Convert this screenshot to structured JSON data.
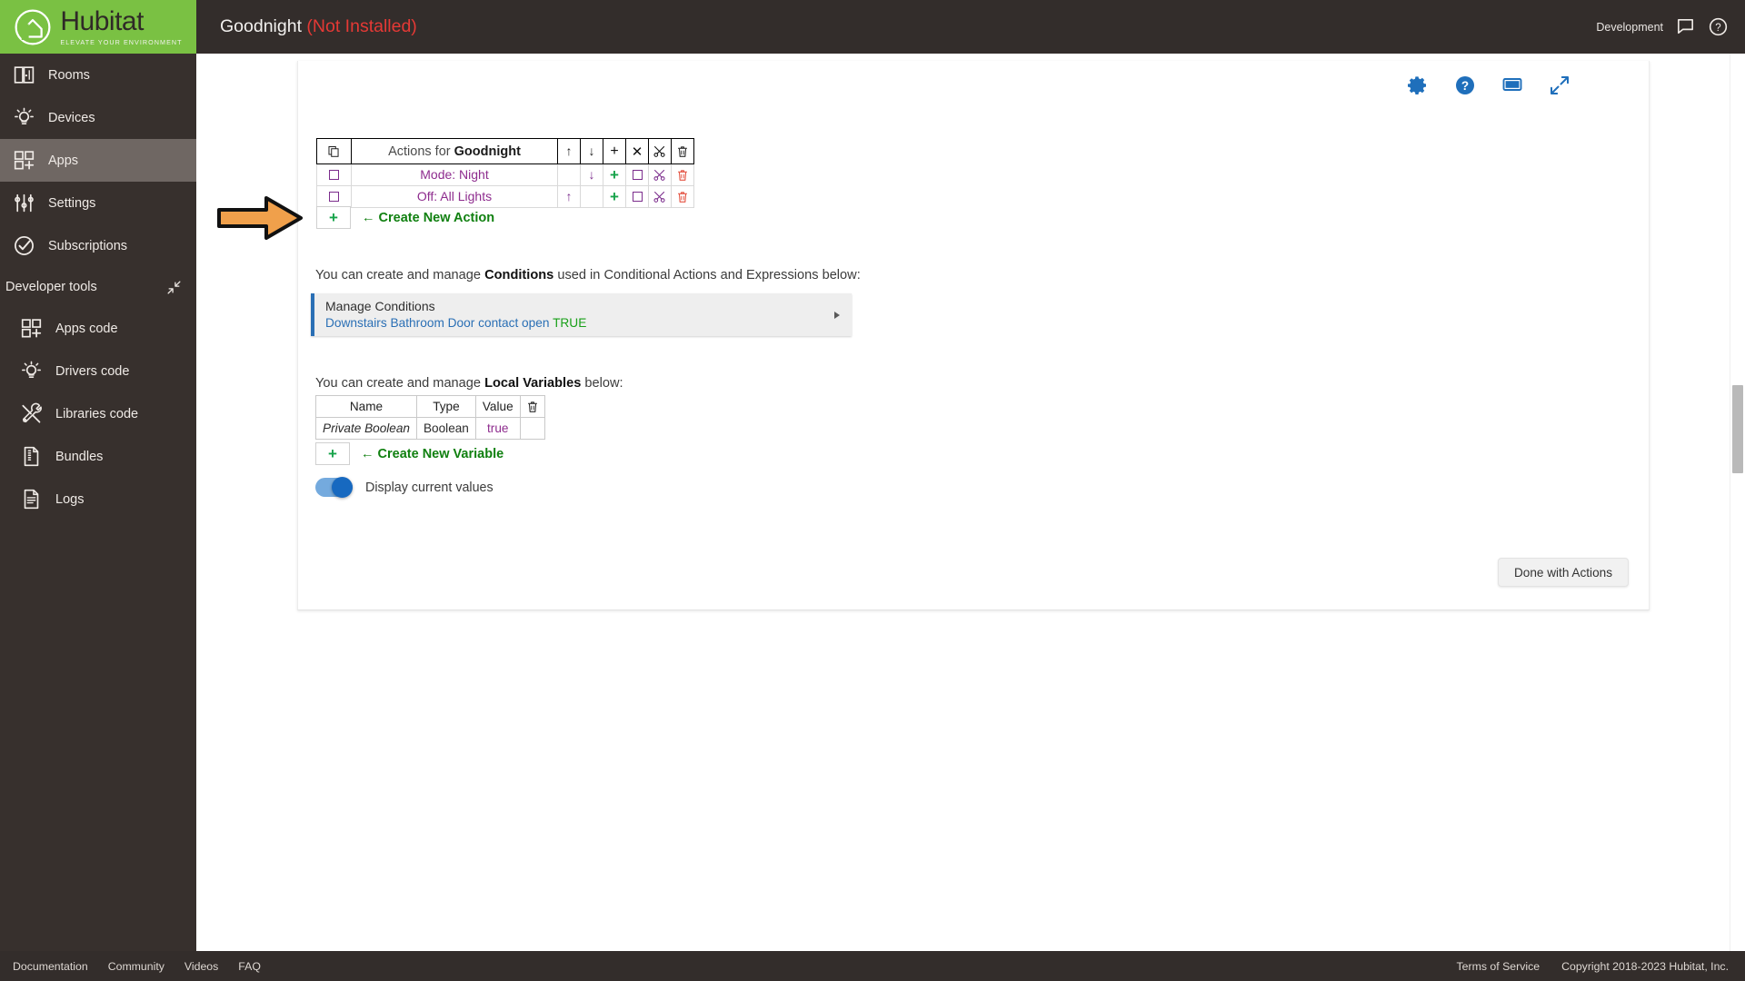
{
  "brand": {
    "name": "Hubitat",
    "tagline": "ELEVATE YOUR ENVIRONMENT",
    "logo_bg": "#7ac143"
  },
  "header": {
    "app_title": "Goodnight",
    "app_status": "(Not Installed)",
    "status_color": "#e53935",
    "environment": "Development",
    "icons": [
      "chat-bubble-icon",
      "help-circle-icon"
    ]
  },
  "sidebar": {
    "items": [
      {
        "label": "Rooms",
        "icon": "rooms-icon",
        "active": false
      },
      {
        "label": "Devices",
        "icon": "devices-bulb-icon",
        "active": false
      },
      {
        "label": "Apps",
        "icon": "apps-grid-icon",
        "active": true
      },
      {
        "label": "Settings",
        "icon": "settings-sliders-icon",
        "active": false
      },
      {
        "label": "Subscriptions",
        "icon": "subscriptions-check-icon",
        "active": false
      }
    ],
    "developer_tools": {
      "label": "Developer tools",
      "collapse_icon": "collapse-arrows-icon",
      "items": [
        {
          "label": "Apps code",
          "icon": "apps-grid-icon"
        },
        {
          "label": "Drivers code",
          "icon": "devices-bulb-icon"
        },
        {
          "label": "Libraries code",
          "icon": "tools-wrench-icon"
        },
        {
          "label": "Bundles",
          "icon": "bundle-zip-icon"
        },
        {
          "label": "Logs",
          "icon": "logs-document-icon"
        }
      ]
    }
  },
  "card_toolbar": {
    "icons": [
      {
        "name": "gear-icon",
        "color": "#1f6fbb"
      },
      {
        "name": "help-circle-icon",
        "color": "#1f6fbb"
      },
      {
        "name": "display-icon",
        "color": "#1f6fbb"
      },
      {
        "name": "expand-icon",
        "color": "#1f6fbb"
      }
    ]
  },
  "actions_table": {
    "header": {
      "copy_icon": "copy-pages-icon",
      "title_prefix": "Actions for ",
      "title_bold": "Goodnight",
      "ops": [
        "↑",
        "↓",
        "+",
        "✕",
        "scissors-icon",
        "trash-icon"
      ]
    },
    "rows": [
      {
        "checkbox": "square-checkbox-icon",
        "label": "Mode: Night",
        "up": "",
        "down": "↓",
        "plus": "+",
        "square": "square-icon",
        "cut": "scissors-icon",
        "delete": "trash-icon"
      },
      {
        "checkbox": "square-checkbox-icon",
        "label": "Off: All Lights",
        "up": "↑",
        "down": "",
        "plus": "+",
        "square": "square-icon",
        "cut": "scissors-icon",
        "delete": "trash-icon"
      }
    ],
    "create_new": {
      "plus": "+",
      "arrow": "←",
      "label": "Create New Action"
    }
  },
  "conditions": {
    "intro_before": "You can create and manage ",
    "intro_bold": "Conditions",
    "intro_after": " used in Conditional Actions and Expressions below:",
    "panel_title": "Manage Conditions",
    "panel_condition": "Downstairs Bathroom Door contact open ",
    "panel_value": "TRUE",
    "accent_color": "#2a6fb5",
    "value_color": "#18a018"
  },
  "variables": {
    "intro_before": "You can create and manage ",
    "intro_bold": "Local Variables",
    "intro_after": " below:",
    "columns": [
      "Name",
      "Type",
      "Value"
    ],
    "delete_icon": "trash-icon",
    "rows": [
      {
        "name": "Private Boolean",
        "type": "Boolean",
        "value": "true"
      }
    ],
    "create_new": {
      "plus": "+",
      "arrow": "←",
      "label": "Create New Variable"
    }
  },
  "display_toggle": {
    "label": "Display current values",
    "state": "on",
    "on_color": "#1769c0"
  },
  "done_button": {
    "label": "Done with Actions"
  },
  "annotation": {
    "pointer": "orange-right-arrow",
    "color": "#f0a04b"
  },
  "footer": {
    "left": [
      "Documentation",
      "Community",
      "Videos",
      "FAQ"
    ],
    "right_link": "Terms of Service",
    "copyright": "Copyright 2018-2023 Hubitat, Inc."
  }
}
